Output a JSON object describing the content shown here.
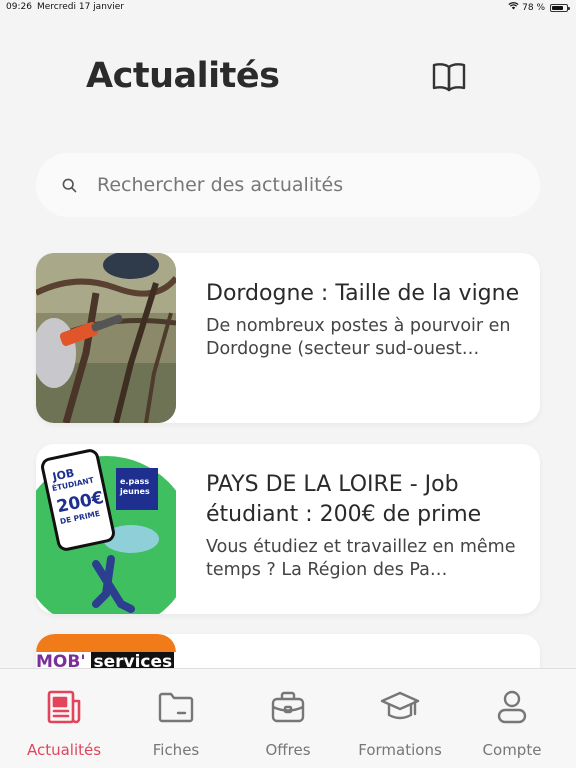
{
  "status_bar": {
    "time": "09:26",
    "date": "Mercredi 17 janvier",
    "battery": "78 %",
    "battery_level": 0.78
  },
  "header": {
    "title": "Actualités",
    "catalog_icon": "book-open-icon"
  },
  "search": {
    "placeholder": "Rechercher des actualités",
    "icon": "search-icon"
  },
  "news": [
    {
      "title": "Dordogne : Taille de la vigne",
      "description": "De nombreux postes à pourvoir en Dordogne (secteur sud-ouest…"
    },
    {
      "title": "PAYS DE LA LOIRE - Job étudiant : 200€ de prime",
      "description": "Vous étudiez et travaillez en même temps ? La Région des Pa…",
      "image_text": {
        "job": "JOB",
        "etudiant": "ÉTUDIANT",
        "amount": "200€",
        "prime": "DE PRIME",
        "epass": "e.pass",
        "jeunes": "jeunes"
      }
    },
    {
      "image_text": "MOB' services"
    }
  ],
  "tabs": [
    {
      "label": "Actualités",
      "icon": "newspaper-icon",
      "active": true
    },
    {
      "label": "Fiches",
      "icon": "folder-icon",
      "active": false
    },
    {
      "label": "Offres",
      "icon": "briefcase-icon",
      "active": false
    },
    {
      "label": "Formations",
      "icon": "graduation-cap-icon",
      "active": false
    },
    {
      "label": "Compte",
      "icon": "user-icon",
      "active": false
    }
  ],
  "colors": {
    "accent": "#e2445c",
    "tab_inactive": "#777777",
    "background": "#f4f4f4",
    "green": "#3fbf5f",
    "navy": "#1e2f8f"
  }
}
